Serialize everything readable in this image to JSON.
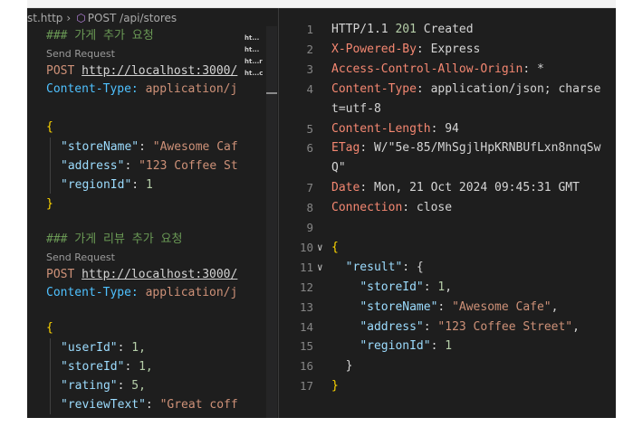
{
  "breadcrumb": {
    "file": "st.http",
    "request": "POST /api/stores"
  },
  "request_editor": {
    "blocks": [
      {
        "comment": "### 가게 추가 요청",
        "codelens": "Send Request",
        "method": "POST",
        "url": "http://localhost:3000/",
        "header_name": "Content-Type:",
        "header_value": " application/j",
        "open_brace": "{",
        "fields": [
          {
            "key": "\"storeName\"",
            "sep": ": ",
            "value": "\"Awesome Caf",
            "kind": "str"
          },
          {
            "key": "\"address\"",
            "sep": ": ",
            "value": "\"123 Coffee St",
            "kind": "str"
          },
          {
            "key": "\"regionId\"",
            "sep": ": ",
            "value": "1",
            "kind": "num"
          }
        ],
        "close_brace": "}"
      },
      {
        "comment": "### 가게 리뷰 추가 요청",
        "codelens": "Send Request",
        "method": "POST",
        "url": "http://localhost:3000/",
        "header_name": "Content-Type:",
        "header_value": " application/j",
        "open_brace": "{",
        "fields": [
          {
            "key": "\"userId\"",
            "sep": ": ",
            "value": "1,",
            "kind": "num"
          },
          {
            "key": "\"storeId\"",
            "sep": ": ",
            "value": "1,",
            "kind": "num"
          },
          {
            "key": "\"rating\"",
            "sep": ": ",
            "value": "5,",
            "kind": "num"
          },
          {
            "key": "\"reviewText\"",
            "sep": ": ",
            "value": "\"Great coff",
            "kind": "str"
          }
        ],
        "close_brace": "}"
      }
    ]
  },
  "minimap_tabs": [
    "ht...",
    "ht...",
    "ht...r",
    "ht...c"
  ],
  "response": {
    "lines": [
      {
        "num": "1",
        "parts": [
          {
            "t": "HTTP/1.1 ",
            "c": "r-hval"
          },
          {
            "t": "201",
            "c": "r-status"
          },
          {
            "t": " Created",
            "c": "r-hval"
          }
        ]
      },
      {
        "num": "2",
        "parts": [
          {
            "t": "X-Powered-By",
            "c": "r-hname"
          },
          {
            "t": ": Express",
            "c": "r-hval"
          }
        ]
      },
      {
        "num": "3",
        "parts": [
          {
            "t": "Access-Control-Allow-Origin",
            "c": "r-hname"
          },
          {
            "t": ": *",
            "c": "r-hval"
          }
        ]
      },
      {
        "num": "4",
        "parts": [
          {
            "t": "Content-Type",
            "c": "r-hname"
          },
          {
            "t": ": application/json; charse",
            "c": "r-hval"
          }
        ]
      },
      {
        "num": "",
        "parts": [
          {
            "t": "t=utf-8",
            "c": "r-hval"
          }
        ]
      },
      {
        "num": "5",
        "parts": [
          {
            "t": "Content-Length",
            "c": "r-hname"
          },
          {
            "t": ": 94",
            "c": "r-hval"
          }
        ]
      },
      {
        "num": "6",
        "parts": [
          {
            "t": "ETag",
            "c": "r-hname"
          },
          {
            "t": ": W/\"5e-85/MhSgjlHpKRNBUfLxn8nnqSw",
            "c": "r-hval"
          }
        ]
      },
      {
        "num": "",
        "parts": [
          {
            "t": "Q\"",
            "c": "r-hval"
          }
        ]
      },
      {
        "num": "7",
        "parts": [
          {
            "t": "Date",
            "c": "r-hname"
          },
          {
            "t": ": Mon, 21 Oct 2024 09:45:31 GMT",
            "c": "r-hval"
          }
        ]
      },
      {
        "num": "8",
        "parts": [
          {
            "t": "Connection",
            "c": "r-hname"
          },
          {
            "t": ": close",
            "c": "r-hval"
          }
        ]
      },
      {
        "num": "9",
        "parts": []
      },
      {
        "num": "10",
        "fold": "∨",
        "parts": [
          {
            "t": "{",
            "c": "c-brace"
          }
        ]
      },
      {
        "num": "11",
        "fold": "∨",
        "parts": [
          {
            "t": "  ",
            "c": "c-punc"
          },
          {
            "t": "\"result\"",
            "c": "c-key"
          },
          {
            "t": ": {",
            "c": "c-punc"
          }
        ]
      },
      {
        "num": "12",
        "parts": [
          {
            "t": "    ",
            "c": "c-punc"
          },
          {
            "t": "\"storeId\"",
            "c": "c-key"
          },
          {
            "t": ": ",
            "c": "c-punc"
          },
          {
            "t": "1",
            "c": "c-num"
          },
          {
            "t": ",",
            "c": "c-punc"
          }
        ]
      },
      {
        "num": "13",
        "parts": [
          {
            "t": "    ",
            "c": "c-punc"
          },
          {
            "t": "\"storeName\"",
            "c": "c-key"
          },
          {
            "t": ": ",
            "c": "c-punc"
          },
          {
            "t": "\"Awesome Cafe\"",
            "c": "c-str"
          },
          {
            "t": ",",
            "c": "c-punc"
          }
        ]
      },
      {
        "num": "14",
        "parts": [
          {
            "t": "    ",
            "c": "c-punc"
          },
          {
            "t": "\"address\"",
            "c": "c-key"
          },
          {
            "t": ": ",
            "c": "c-punc"
          },
          {
            "t": "\"123 Coffee Street\"",
            "c": "c-str"
          },
          {
            "t": ",",
            "c": "c-punc"
          }
        ]
      },
      {
        "num": "15",
        "parts": [
          {
            "t": "    ",
            "c": "c-punc"
          },
          {
            "t": "\"regionId\"",
            "c": "c-key"
          },
          {
            "t": ": ",
            "c": "c-punc"
          },
          {
            "t": "1",
            "c": "c-num"
          }
        ]
      },
      {
        "num": "16",
        "parts": [
          {
            "t": "  }",
            "c": "c-punc"
          }
        ]
      },
      {
        "num": "17",
        "parts": [
          {
            "t": "}",
            "c": "c-brace"
          }
        ]
      }
    ]
  }
}
